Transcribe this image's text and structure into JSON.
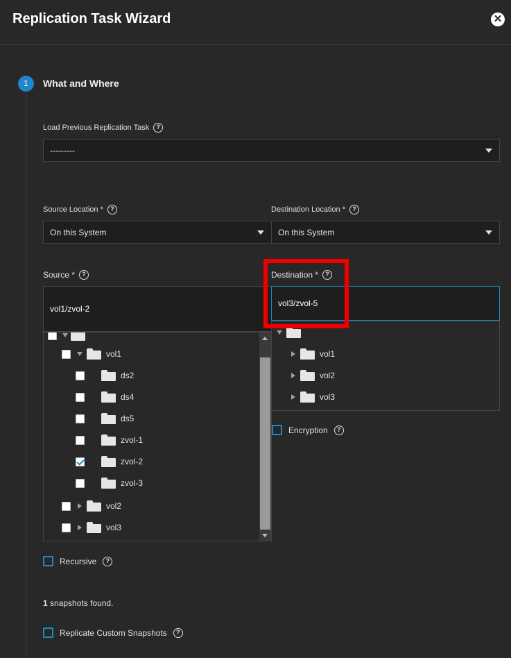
{
  "dialog": {
    "title": "Replication Task Wizard",
    "close_icon": "close-icon"
  },
  "step": {
    "number": "1",
    "title": "What and Where"
  },
  "load_previous": {
    "label": "Load Previous Replication Task",
    "value": "---------"
  },
  "source_location": {
    "label": "Source Location *",
    "value": "On this System"
  },
  "destination_location": {
    "label": "Destination Location *",
    "value": "On this System"
  },
  "source": {
    "label": "Source *",
    "value": "vol1/zvol-2",
    "tree": {
      "vol1": "vol1",
      "children": [
        "ds2",
        "ds4",
        "ds5",
        "zvol-1",
        "zvol-2",
        "zvol-3"
      ],
      "checked": "zvol-2",
      "vol2": "vol2",
      "vol3": "vol3"
    }
  },
  "destination": {
    "label": "Destination *",
    "value": "vol3/zvol-5",
    "tree": [
      "vol1",
      "vol2",
      "vol3"
    ]
  },
  "encryption": {
    "label": "Encryption"
  },
  "recursive": {
    "label": "Recursive"
  },
  "snapshots": {
    "count": "1",
    "text": "snapshots found."
  },
  "custom_snapshots": {
    "label": "Replicate Custom Snapshots"
  },
  "colors": {
    "accent": "#1f86c8",
    "highlight": "#ee0000",
    "background": "#282828"
  }
}
